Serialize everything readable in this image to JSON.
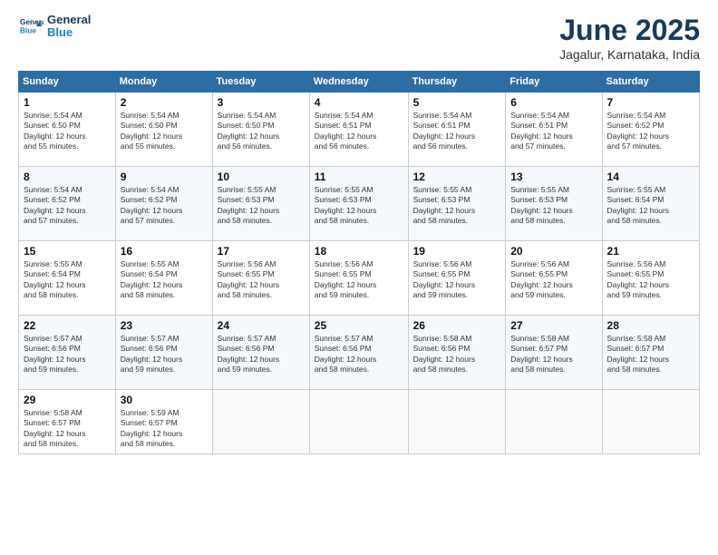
{
  "header": {
    "logo_line1": "General",
    "logo_line2": "Blue",
    "month": "June 2025",
    "location": "Jagalur, Karnataka, India"
  },
  "days_of_week": [
    "Sunday",
    "Monday",
    "Tuesday",
    "Wednesday",
    "Thursday",
    "Friday",
    "Saturday"
  ],
  "weeks": [
    [
      {
        "day": 1,
        "info": "Sunrise: 5:54 AM\nSunset: 6:50 PM\nDaylight: 12 hours\nand 55 minutes."
      },
      {
        "day": 2,
        "info": "Sunrise: 5:54 AM\nSunset: 6:50 PM\nDaylight: 12 hours\nand 55 minutes."
      },
      {
        "day": 3,
        "info": "Sunrise: 5:54 AM\nSunset: 6:50 PM\nDaylight: 12 hours\nand 56 minutes."
      },
      {
        "day": 4,
        "info": "Sunrise: 5:54 AM\nSunset: 6:51 PM\nDaylight: 12 hours\nand 56 minutes."
      },
      {
        "day": 5,
        "info": "Sunrise: 5:54 AM\nSunset: 6:51 PM\nDaylight: 12 hours\nand 56 minutes."
      },
      {
        "day": 6,
        "info": "Sunrise: 5:54 AM\nSunset: 6:51 PM\nDaylight: 12 hours\nand 57 minutes."
      },
      {
        "day": 7,
        "info": "Sunrise: 5:54 AM\nSunset: 6:52 PM\nDaylight: 12 hours\nand 57 minutes."
      }
    ],
    [
      {
        "day": 8,
        "info": "Sunrise: 5:54 AM\nSunset: 6:52 PM\nDaylight: 12 hours\nand 57 minutes."
      },
      {
        "day": 9,
        "info": "Sunrise: 5:54 AM\nSunset: 6:52 PM\nDaylight: 12 hours\nand 57 minutes."
      },
      {
        "day": 10,
        "info": "Sunrise: 5:55 AM\nSunset: 6:53 PM\nDaylight: 12 hours\nand 58 minutes."
      },
      {
        "day": 11,
        "info": "Sunrise: 5:55 AM\nSunset: 6:53 PM\nDaylight: 12 hours\nand 58 minutes."
      },
      {
        "day": 12,
        "info": "Sunrise: 5:55 AM\nSunset: 6:53 PM\nDaylight: 12 hours\nand 58 minutes."
      },
      {
        "day": 13,
        "info": "Sunrise: 5:55 AM\nSunset: 6:53 PM\nDaylight: 12 hours\nand 58 minutes."
      },
      {
        "day": 14,
        "info": "Sunrise: 5:55 AM\nSunset: 6:54 PM\nDaylight: 12 hours\nand 58 minutes."
      }
    ],
    [
      {
        "day": 15,
        "info": "Sunrise: 5:55 AM\nSunset: 6:54 PM\nDaylight: 12 hours\nand 58 minutes."
      },
      {
        "day": 16,
        "info": "Sunrise: 5:55 AM\nSunset: 6:54 PM\nDaylight: 12 hours\nand 58 minutes."
      },
      {
        "day": 17,
        "info": "Sunrise: 5:56 AM\nSunset: 6:55 PM\nDaylight: 12 hours\nand 58 minutes."
      },
      {
        "day": 18,
        "info": "Sunrise: 5:56 AM\nSunset: 6:55 PM\nDaylight: 12 hours\nand 59 minutes."
      },
      {
        "day": 19,
        "info": "Sunrise: 5:56 AM\nSunset: 6:55 PM\nDaylight: 12 hours\nand 59 minutes."
      },
      {
        "day": 20,
        "info": "Sunrise: 5:56 AM\nSunset: 6:55 PM\nDaylight: 12 hours\nand 59 minutes."
      },
      {
        "day": 21,
        "info": "Sunrise: 5:56 AM\nSunset: 6:55 PM\nDaylight: 12 hours\nand 59 minutes."
      }
    ],
    [
      {
        "day": 22,
        "info": "Sunrise: 5:57 AM\nSunset: 6:56 PM\nDaylight: 12 hours\nand 59 minutes."
      },
      {
        "day": 23,
        "info": "Sunrise: 5:57 AM\nSunset: 6:56 PM\nDaylight: 12 hours\nand 59 minutes."
      },
      {
        "day": 24,
        "info": "Sunrise: 5:57 AM\nSunset: 6:56 PM\nDaylight: 12 hours\nand 59 minutes."
      },
      {
        "day": 25,
        "info": "Sunrise: 5:57 AM\nSunset: 6:56 PM\nDaylight: 12 hours\nand 58 minutes."
      },
      {
        "day": 26,
        "info": "Sunrise: 5:58 AM\nSunset: 6:56 PM\nDaylight: 12 hours\nand 58 minutes."
      },
      {
        "day": 27,
        "info": "Sunrise: 5:58 AM\nSunset: 6:57 PM\nDaylight: 12 hours\nand 58 minutes."
      },
      {
        "day": 28,
        "info": "Sunrise: 5:58 AM\nSunset: 6:57 PM\nDaylight: 12 hours\nand 58 minutes."
      }
    ],
    [
      {
        "day": 29,
        "info": "Sunrise: 5:58 AM\nSunset: 6:57 PM\nDaylight: 12 hours\nand 58 minutes."
      },
      {
        "day": 30,
        "info": "Sunrise: 5:59 AM\nSunset: 6:57 PM\nDaylight: 12 hours\nand 58 minutes."
      },
      null,
      null,
      null,
      null,
      null
    ]
  ]
}
